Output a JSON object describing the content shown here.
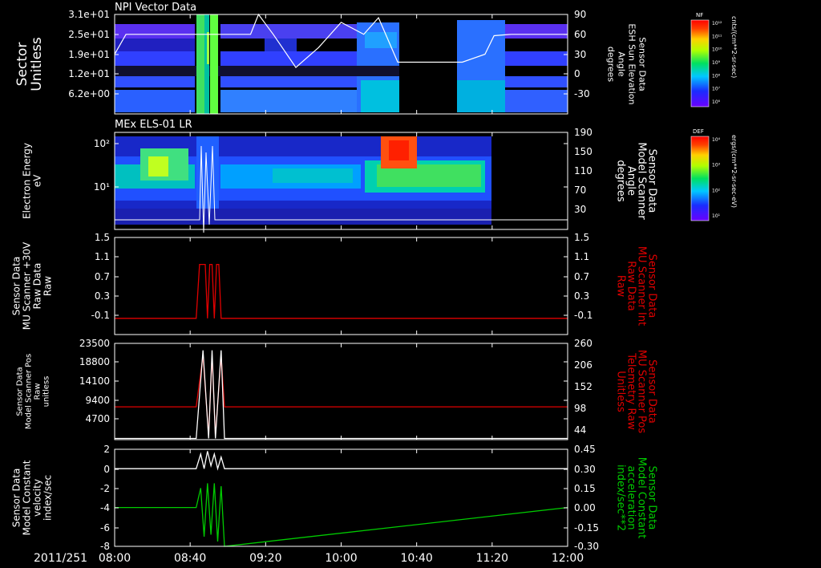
{
  "figure": {
    "date_label": "2011/251",
    "x_ticks": [
      "08:00",
      "08:40",
      "09:20",
      "10:00",
      "10:40",
      "11:20",
      "12:00"
    ],
    "x_range_hours": [
      8.0,
      12.0
    ],
    "background": "#000000",
    "foreground": "#ffffff"
  },
  "chart_data": [
    {
      "type": "heatmap",
      "panel": "p1",
      "title": "NPI Vector Data",
      "ylabel": [
        "Sector",
        "Unitless"
      ],
      "y_ticks": [
        "3.1e+01",
        "2.5e+01",
        "1.9e+01",
        "1.2e+01",
        "6.2e+00"
      ],
      "right_ylabel": [
        "Sensor Data",
        "ESH Sun Elevation",
        "Angle",
        "degrees"
      ],
      "right_y_ticks": [
        "90",
        "60",
        "30",
        "0",
        "-30"
      ],
      "right_ylim": [
        -60,
        90
      ],
      "line_series": {
        "x": [
          8.0,
          8.1,
          8.33,
          8.67,
          9.0,
          9.2,
          9.27,
          9.4,
          9.6,
          9.8,
          10.0,
          10.2,
          10.33,
          10.5,
          10.67,
          10.87,
          11.07,
          11.27,
          11.35,
          11.5,
          12.0
        ],
        "y": [
          30,
          60,
          60,
          60,
          60,
          60,
          90,
          60,
          10,
          40,
          78,
          60,
          85,
          18,
          18,
          18,
          18,
          30,
          58,
          60,
          60
        ]
      },
      "colorbar": {
        "label": "NF",
        "units": "cnts/(cm**2-sr-sec)",
        "tick_labels": [
          "10¹²",
          "10¹¹",
          "10¹⁰",
          "10⁹",
          "10⁸",
          "10⁷",
          "10⁶"
        ]
      }
    },
    {
      "type": "heatmap",
      "panel": "p2",
      "title": "MEx ELS-01 LR",
      "ylabel": [
        "Electron Energy",
        "eV"
      ],
      "y_ticks": [
        "10²",
        "10¹"
      ],
      "right_ylabel": [
        "Sensor Data",
        "Model Scanner",
        "Angle",
        "degrees"
      ],
      "right_y_ticks": [
        "190",
        "150",
        "110",
        "70",
        "30"
      ],
      "right_ylim": [
        10,
        190
      ],
      "colorbar": {
        "label": "DEF",
        "units": "ergs/(cm**2-sr-sec-eV)",
        "tick_labels": [
          "10⁴",
          "10³",
          "10²",
          "10¹"
        ]
      }
    },
    {
      "type": "line",
      "panel": "p3",
      "ylabel": [
        "Sensor Data",
        "MU Scanner +30V",
        "Raw Data",
        "Raw"
      ],
      "y_ticks": [
        "1.5",
        "1.1",
        "0.7",
        "0.3",
        "-0.1"
      ],
      "ylim": [
        -0.3,
        1.5
      ],
      "right_ylabel": [
        "Sensor Data",
        "MU Scanner Int",
        "Raw Data",
        "Raw"
      ],
      "right_y_ticks": [
        "1.5",
        "1.1",
        "0.7",
        "0.3",
        "-0.1"
      ],
      "series": [
        {
          "color": "#e00000",
          "x": [
            8.0,
            8.72,
            8.75,
            8.8,
            8.82,
            8.84,
            8.86,
            8.88,
            8.9,
            8.92,
            8.94,
            8.96,
            12.0
          ],
          "y": [
            0.0,
            0.0,
            1.0,
            1.0,
            0.0,
            1.0,
            1.0,
            0.0,
            1.0,
            1.0,
            0.0,
            0.0,
            0.0
          ]
        }
      ]
    },
    {
      "type": "line",
      "panel": "p4",
      "ylabel": [
        "Sensor Data",
        "Model Scanner Pos",
        "Raw",
        "unitless"
      ],
      "y_ticks": [
        "23500",
        "18800",
        "14100",
        "9400",
        "4700"
      ],
      "ylim": [
        0,
        23500
      ],
      "right_ylabel": [
        "Sensor Data",
        "MU Scanner Pos",
        "Telemetry Raw",
        "Unitless"
      ],
      "right_y_ticks": [
        "260",
        "206",
        "152",
        "98",
        "44"
      ],
      "series": [
        {
          "color": "#e00000",
          "x": [
            8.0,
            8.72,
            8.78,
            8.83,
            8.86,
            8.89,
            8.94,
            8.97,
            12.0
          ],
          "y": [
            8000,
            8000,
            20500,
            1000,
            20500,
            1000,
            20500,
            8000,
            8000
          ]
        },
        {
          "color": "#ffffff",
          "x": [
            8.0,
            8.72,
            8.78,
            8.83,
            8.86,
            8.89,
            8.94,
            8.97,
            12.0
          ],
          "y": [
            300,
            300,
            21800,
            300,
            21800,
            300,
            21800,
            300,
            300
          ]
        }
      ]
    },
    {
      "type": "line",
      "panel": "p5",
      "ylabel": [
        "Sensor Data",
        "Model Constant",
        "velocity",
        "index/sec"
      ],
      "y_ticks": [
        "2",
        "0",
        "-2",
        "-4",
        "-6",
        "-8"
      ],
      "ylim": [
        -8,
        2
      ],
      "right_ylabel": [
        "Sensor Data",
        "Model Constant",
        "acceleration",
        "index/sec**2"
      ],
      "right_y_ticks": [
        "0.45",
        "0.30",
        "0.15",
        "0.00",
        "-0.15",
        "-0.30"
      ],
      "series": [
        {
          "color": "#ffffff",
          "x": [
            8.0,
            8.72,
            8.76,
            8.79,
            8.82,
            8.85,
            8.88,
            8.91,
            8.94,
            8.97,
            12.0
          ],
          "y": [
            0,
            0,
            1.5,
            0,
            1.8,
            0.3,
            1.5,
            0,
            1.2,
            0,
            0
          ]
        },
        {
          "color": "#00cc00",
          "x": [
            8.0,
            8.72,
            8.76,
            8.79,
            8.82,
            8.85,
            8.88,
            8.91,
            8.94,
            8.97,
            12.0
          ],
          "y": [
            -4,
            -4,
            -2,
            -7,
            -1.5,
            -6.8,
            -1.5,
            -7.5,
            -1.8,
            -8,
            -4
          ]
        }
      ]
    }
  ]
}
